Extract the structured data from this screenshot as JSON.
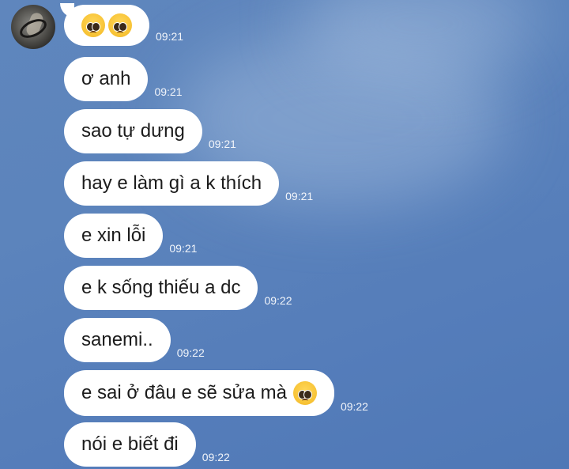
{
  "chat": {
    "messages": [
      {
        "text": "",
        "time": "09:21",
        "emoji": [
          "pleading-face",
          "pleading-face"
        ]
      },
      {
        "text": "ơ anh",
        "time": "09:21"
      },
      {
        "text": "sao tự dưng",
        "time": "09:21"
      },
      {
        "text": "hay e làm gì a k thích",
        "time": "09:21"
      },
      {
        "text": "e xin lỗi",
        "time": "09:21"
      },
      {
        "text": "e k sống thiếu a dc",
        "time": "09:22"
      },
      {
        "text": "sanemi..",
        "time": "09:22"
      },
      {
        "text": "e sai ở đâu e sẽ sửa mà",
        "time": "09:22",
        "emoji": [
          "pleading-face"
        ]
      },
      {
        "text": "nói e biết đi",
        "time": "09:22"
      }
    ]
  }
}
